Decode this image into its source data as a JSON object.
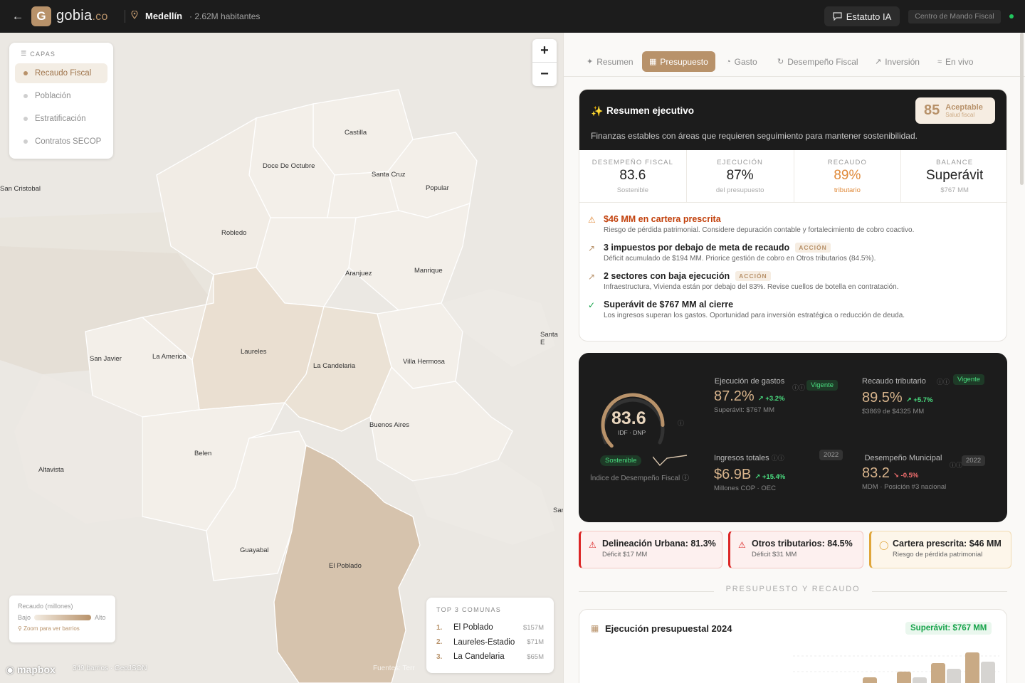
{
  "header": {
    "back_icon": "arrow-left-icon",
    "logo_letter": "G",
    "brand": "gobia",
    "brand_tld": ".co",
    "city": "Medellín",
    "population": "· 2.62M habitantes",
    "estatuto_label": "Estatuto IA",
    "mando_label": "Centro de Mando Fiscal"
  },
  "map": {
    "layers_title": "CAPAS",
    "layers": [
      {
        "label": "Recaudo Fiscal",
        "active": true
      },
      {
        "label": "Población",
        "active": false
      },
      {
        "label": "Estratificación",
        "active": false
      },
      {
        "label": "Contratos SECOP",
        "active": false
      }
    ],
    "zoom_in": "+",
    "zoom_out": "−",
    "labels": {
      "castilla": "Castilla",
      "doce": "Doce De Octubre",
      "santacruz": "Santa Cruz",
      "popular": "Popular",
      "sancristobal": "San Cristobal",
      "robledo": "Robledo",
      "aranjuez": "Aranjuez",
      "manrique": "Manrique",
      "santae": "Santa E",
      "sanjavier": "San Javier",
      "laamerica": "La America",
      "laureles": "Laureles",
      "lacandelaria": "La Candelaria",
      "villahermosa": "Villa Hermosa",
      "buenosaires": "Buenos Aires",
      "belen": "Belen",
      "altavista": "Altavista",
      "sar": "Sar",
      "guayabal": "Guayabal",
      "elpoblado": "El Poblado"
    },
    "legend": {
      "title": "Recaudo (millones)",
      "low": "Bajo",
      "high": "Alto",
      "zoom_hint": "Zoom para ver barrios"
    },
    "top3": {
      "title": "TOP 3 COMUNAS",
      "items": [
        {
          "rank": "1.",
          "name": "El Poblado",
          "value": "$157M"
        },
        {
          "rank": "2.",
          "name": "Laureles-Estadio",
          "value": "$71M"
        },
        {
          "rank": "3.",
          "name": "La Candelaria",
          "value": "$65M"
        }
      ]
    },
    "footer": "349 barrios · GeoJSON",
    "fuentes": "Fuentes: Terr",
    "attribution": "mapbox"
  },
  "tabs": [
    {
      "label": "Resumen",
      "icon": "sparkle-icon"
    },
    {
      "label": "Presupuesto",
      "icon": "bar-chart-icon",
      "active": true
    },
    {
      "label": "Gasto",
      "icon": "pie-icon"
    },
    {
      "label": "Desempeño Fiscal",
      "icon": "refresh-icon"
    },
    {
      "label": "Inversión",
      "icon": "trend-icon"
    },
    {
      "label": "En vivo",
      "icon": "wifi-icon"
    }
  ],
  "exec": {
    "title": "Resumen ejecutivo",
    "subtitle": "Finanzas estables con áreas que requieren seguimiento para mantener sostenibilidad.",
    "health_score": "85",
    "health_label": "Aceptable",
    "health_sub": "Salud fiscal",
    "kpis": [
      {
        "label": "DESEMPEÑO FISCAL",
        "value": "83.6",
        "sub": "Sostenible"
      },
      {
        "label": "EJECUCIÓN",
        "value": "87%",
        "sub": "del presupuesto"
      },
      {
        "label": "RECAUDO",
        "value": "89%",
        "sub": "tributario"
      },
      {
        "label": "BALANCE",
        "value": "Superávit",
        "sub": "$767 MM"
      }
    ],
    "alerts": [
      {
        "title": "$46 MM en cartera prescrita",
        "desc": "Riesgo de pérdida patrimonial. Considere depuración contable y fortalecimiento de cobro coactivo.",
        "badge": ""
      },
      {
        "title": "3 impuestos por debajo de meta de recaudo",
        "desc": "Déficit acumulado de $194 MM. Priorice gestión de cobro en Otros tributarios (84.5%).",
        "badge": "ACCIÓN"
      },
      {
        "title": "2 sectores con baja ejecución",
        "desc": "Infraestructura, Vivienda están por debajo del 83%. Revise cuellos de botella en contratación.",
        "badge": "ACCIÓN"
      },
      {
        "title": "Superávit de $767 MM al cierre",
        "desc": "Los ingresos superan los gastos. Oportunidad para inversión estratégica o reducción de deuda.",
        "badge": ""
      }
    ]
  },
  "idf": {
    "value": "83.6",
    "gauge_fraction": 0.836,
    "sub": "IDF · DNP",
    "status": "Sostenible",
    "label": "Índice de Desempeño Fiscal",
    "metrics": {
      "gastos": {
        "label": "Ejecución de gastos",
        "value": "87.2%",
        "delta": "+3.2%",
        "sub": "Superávit: $767 MM",
        "badge": "Vigente"
      },
      "recaudo": {
        "label": "Recaudo tributario",
        "value": "89.5%",
        "delta": "+5.7%",
        "sub": "$3869 de $4325 MM",
        "badge": "Vigente"
      },
      "ingresos": {
        "label": "Ingresos totales",
        "value": "$6.9B",
        "delta": "+15.4%",
        "sub": "Millones COP · OEC",
        "badge": "2022"
      },
      "mdm": {
        "label": "Desempeño Municipal",
        "value": "83.2",
        "delta": "-0.5%",
        "sub": "MDM · Posición #3 nacional",
        "badge": "2022"
      }
    }
  },
  "warn_cards": [
    {
      "title": "Delineación Urbana: 81.3%",
      "sub": "Déficit $17 MM"
    },
    {
      "title": "Otros tributarios: 84.5%",
      "sub": "Déficit $31 MM"
    },
    {
      "title": "Cartera prescrita: $46 MM",
      "sub": "Riesgo de pérdida patrimonial"
    }
  ],
  "section_title": "PRESUPUESTO Y RECAUDO",
  "budget": {
    "title": "Ejecución presupuestal 2024",
    "badge": "Superávit: $767 MM"
  },
  "colors": {
    "accent": "#b8926a",
    "dark": "#1c1c1c",
    "positive": "#4ade80",
    "warning": "#e08a3a",
    "danger": "#dc2626"
  }
}
